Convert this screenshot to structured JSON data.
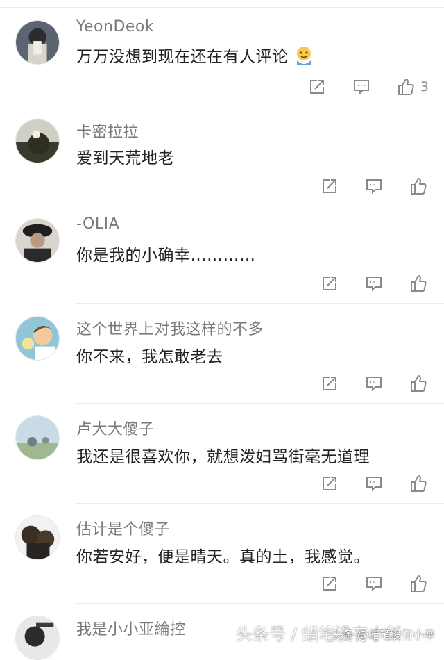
{
  "comments": [
    {
      "username": "YeonDeok",
      "text": "万万没想到现在还在有人评论",
      "emoji": "😓",
      "likes": "3"
    },
    {
      "username": "卡密拉拉",
      "text": "爱到天荒地老",
      "likes": ""
    },
    {
      "username": "-OLIA",
      "text": "你是我的小确幸…………",
      "likes": ""
    },
    {
      "username": "这个世界上对我这样的不多",
      "text": "你不来，我怎敢老去",
      "likes": ""
    },
    {
      "username": "卢大大傻子",
      "text": "我还是很喜欢你，就想泼妇骂街毫无道理",
      "likes": ""
    },
    {
      "username": "估计是个傻子",
      "text": "你若安好，便是晴天。真的土，我感觉。",
      "likes": ""
    },
    {
      "username": "我是小小亚綸控",
      "text": "",
      "likes": ""
    }
  ],
  "icons": {
    "share": "share-icon",
    "reply": "reply-icon",
    "like": "thumbs-up-icon"
  },
  "watermark": {
    "text": "头条号 / 蜡笔没有小新",
    "credit": "头条 @蜡笔没有小辛"
  },
  "colors": {
    "username": "#7a7a7a",
    "text": "#222222",
    "icon": "#8a8a8a",
    "divider": "#ececec"
  }
}
